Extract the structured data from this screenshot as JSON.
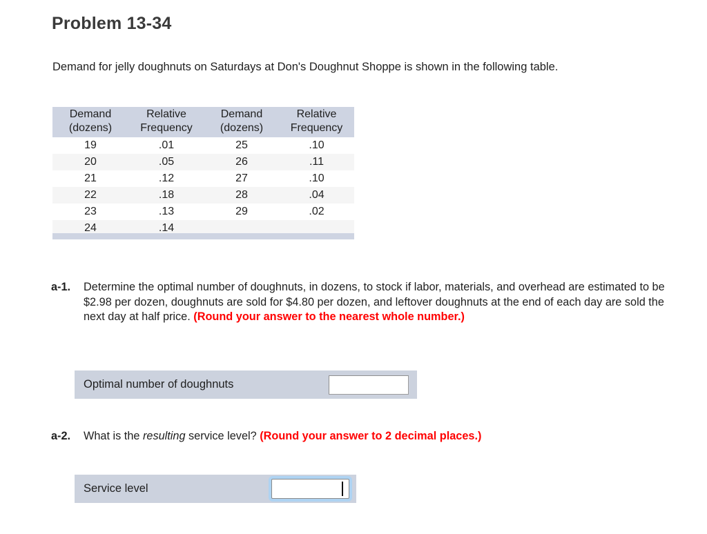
{
  "problem": {
    "title": "Problem 13-34",
    "intro": "Demand for jelly doughnuts on Saturdays at Don's Doughnut Shoppe is shown in the following table."
  },
  "table": {
    "headers": [
      {
        "line1": "Demand",
        "line2": "(dozens)"
      },
      {
        "line1": "Relative",
        "line2": "Frequency"
      },
      {
        "line1": "Demand",
        "line2": "(dozens)"
      },
      {
        "line1": "Relative",
        "line2": "Frequency"
      }
    ],
    "rows": [
      {
        "demand_left": "19",
        "freq_left": ".01",
        "demand_right": "25",
        "freq_right": ".10"
      },
      {
        "demand_left": "20",
        "freq_left": ".05",
        "demand_right": "26",
        "freq_right": ".11"
      },
      {
        "demand_left": "21",
        "freq_left": ".12",
        "demand_right": "27",
        "freq_right": ".10"
      },
      {
        "demand_left": "22",
        "freq_left": ".18",
        "demand_right": "28",
        "freq_right": ".04"
      },
      {
        "demand_left": "23",
        "freq_left": ".13",
        "demand_right": "29",
        "freq_right": ".02"
      },
      {
        "demand_left": "24",
        "freq_left": ".14",
        "demand_right": "",
        "freq_right": ""
      }
    ]
  },
  "questions": {
    "a1": {
      "label": "a-1.",
      "text": "Determine the optimal number of doughnuts, in dozens, to stock if labor, materials, and overhead are estimated to be $2.98 per dozen, doughnuts are sold for $4.80 per dozen, and leftover doughnuts at the end of each day are sold the next day at half price. ",
      "emphasis": "(Round your answer to the nearest whole number.)",
      "answer_label": "Optimal number of doughnuts",
      "answer_value": ""
    },
    "a2": {
      "label": "a-2.",
      "text_before": "What is the ",
      "text_italic": "resulting",
      "text_after": " service level? ",
      "emphasis": "(Round your answer to 2 decimal places.)",
      "answer_label": "Service level",
      "answer_value": ""
    }
  },
  "colors": {
    "header_bg": "#ced4e2",
    "row_stripe": "#f5f5f5",
    "answer_row_bg": "#ccd2de",
    "emphasis_red": "#ff0000",
    "focus_blue": "#aed3f2"
  }
}
